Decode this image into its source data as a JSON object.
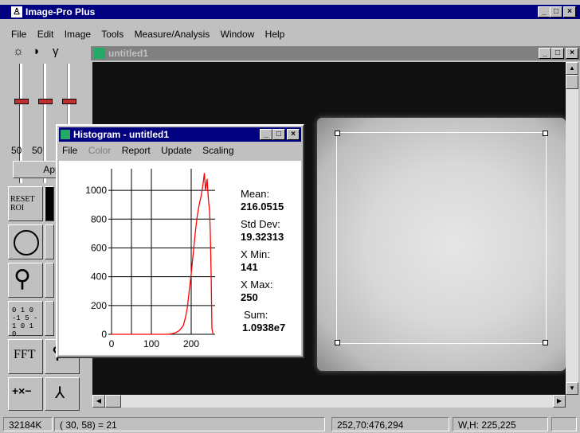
{
  "app": {
    "title": "Image-Pro Plus",
    "menu": [
      "File",
      "Edit",
      "Image",
      "Tools",
      "Measure/Analysis",
      "Window",
      "Help"
    ]
  },
  "controls": {
    "slider_values": [
      "50",
      "50"
    ],
    "apply_label": "App",
    "reset_roi_label": "RESET ROI",
    "fft_label": "FFT",
    "kernel_label": "0 1 0 -1 5 -1 0 1 0",
    "math_label": "+×−"
  },
  "image_window": {
    "title": "untitled1"
  },
  "histogram": {
    "title": "Histogram - untitled1",
    "menu": [
      "File",
      "Color",
      "Report",
      "Update",
      "Scaling"
    ],
    "menu_disabled": [
      "Color"
    ],
    "stats": {
      "mean_label": "Mean:",
      "mean_value": "216.0515",
      "std_label": "Std Dev:",
      "std_value": "19.32313",
      "xmin_label": "X Min:",
      "xmin_value": "141",
      "xmax_label": "X Max:",
      "xmax_value": "250",
      "sum_label": "Sum:",
      "sum_value": "1.0938e7"
    }
  },
  "chart_data": {
    "type": "line",
    "x": [
      0,
      140,
      150,
      160,
      170,
      180,
      185,
      190,
      195,
      200,
      205,
      210,
      215,
      220,
      225,
      230,
      233,
      236,
      240,
      243,
      246,
      248,
      250,
      252,
      255
    ],
    "series": [
      {
        "values": [
          0,
          0,
          3,
          10,
          25,
          60,
          110,
          180,
          300,
          420,
          560,
          700,
          820,
          900,
          960,
          1050,
          1120,
          1000,
          1080,
          940,
          860,
          700,
          420,
          40,
          0
        ]
      }
    ],
    "xlim": [
      0,
      260
    ],
    "ylim": [
      0,
      1150
    ],
    "xticks": [
      "0",
      "100",
      "200"
    ],
    "xtick_values": [
      0,
      100,
      200
    ],
    "yticks": [
      "0",
      "200",
      "400",
      "600",
      "800",
      "1000"
    ],
    "ytick_values": [
      0,
      200,
      400,
      600,
      800,
      1000
    ],
    "grid": true,
    "line_color": "#ff0000"
  },
  "status": {
    "memory": "32184K",
    "pixel": "( 30,  58) = 21",
    "coords": "252,70:476,294",
    "size": "W,H: 225,225"
  },
  "colors": {
    "titlebar": "#000080",
    "desktop": "#6fa0d0",
    "face": "#c0c0c0",
    "histogram_line": "#ff0000"
  }
}
